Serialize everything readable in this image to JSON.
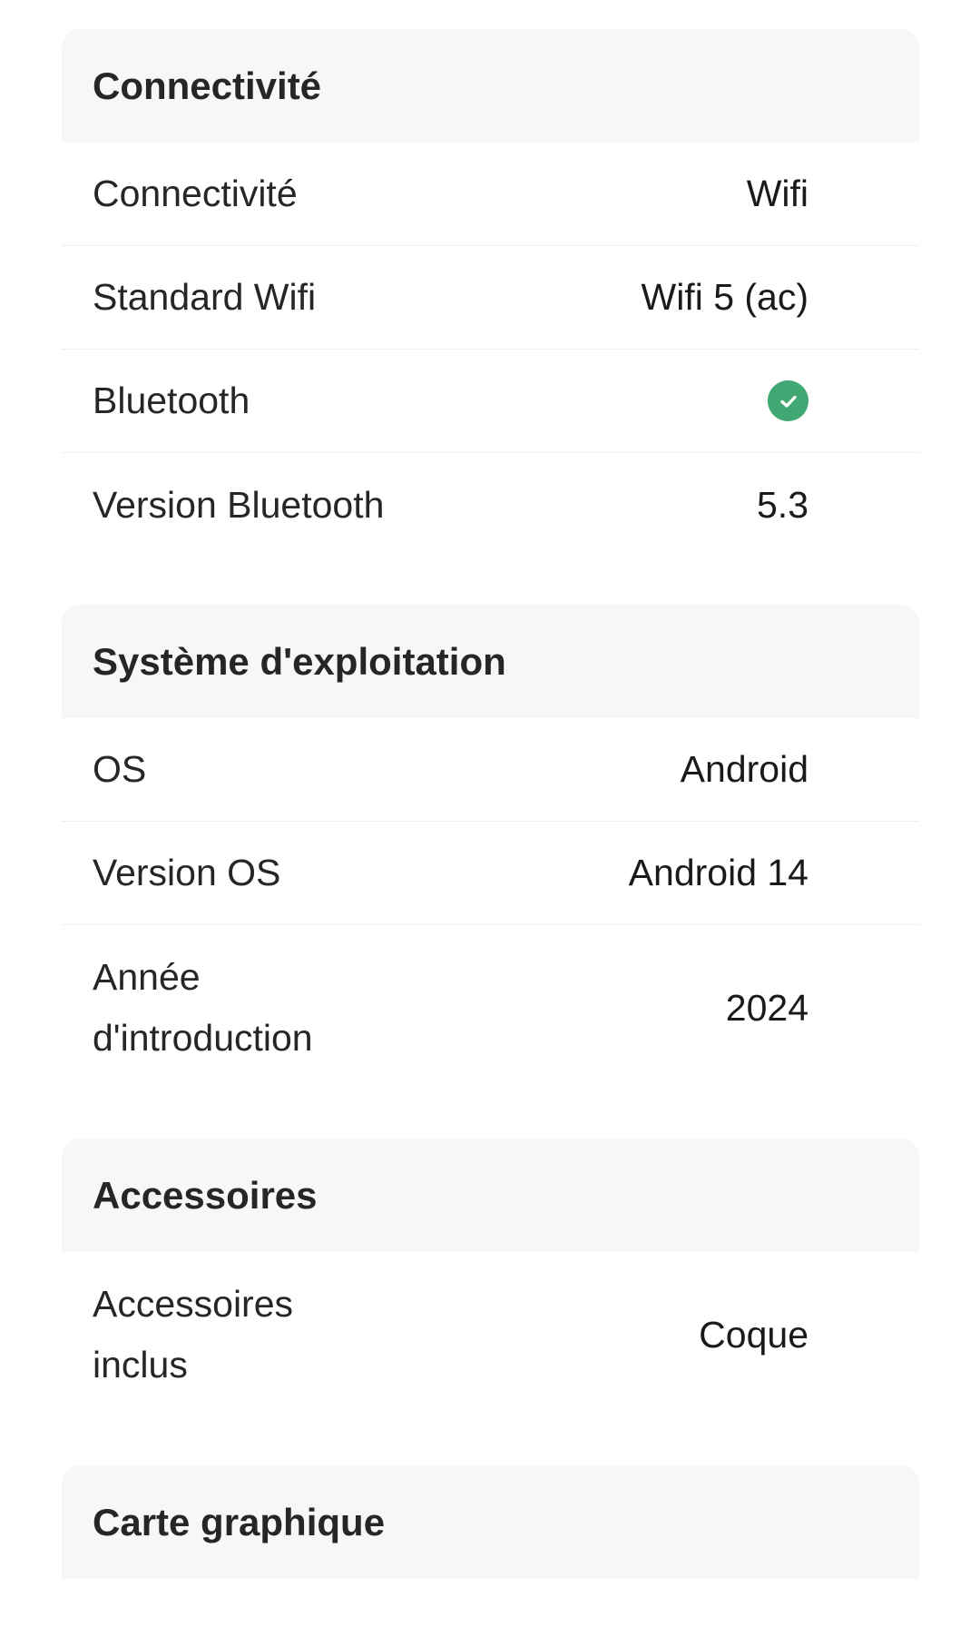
{
  "sections": [
    {
      "title": "Connectivité",
      "rows": [
        {
          "label": "Connectivité",
          "value": "Wifi"
        },
        {
          "label": "Standard Wifi",
          "value": "Wifi 5 (ac)"
        },
        {
          "label": "Bluetooth",
          "value_icon": "check-circle-icon",
          "value_color": "#42a873"
        },
        {
          "label": "Version Bluetooth",
          "value": "5.3"
        }
      ]
    },
    {
      "title": "Système d'exploitation",
      "rows": [
        {
          "label": "OS",
          "value": "Android"
        },
        {
          "label": "Version OS",
          "value": "Android 14"
        },
        {
          "label": "Année d'introduction",
          "value": "2024"
        }
      ]
    },
    {
      "title": "Accessoires",
      "rows": [
        {
          "label": "Accessoires inclus",
          "value": "Coque"
        }
      ]
    },
    {
      "title": "Carte graphique",
      "rows": []
    }
  ]
}
